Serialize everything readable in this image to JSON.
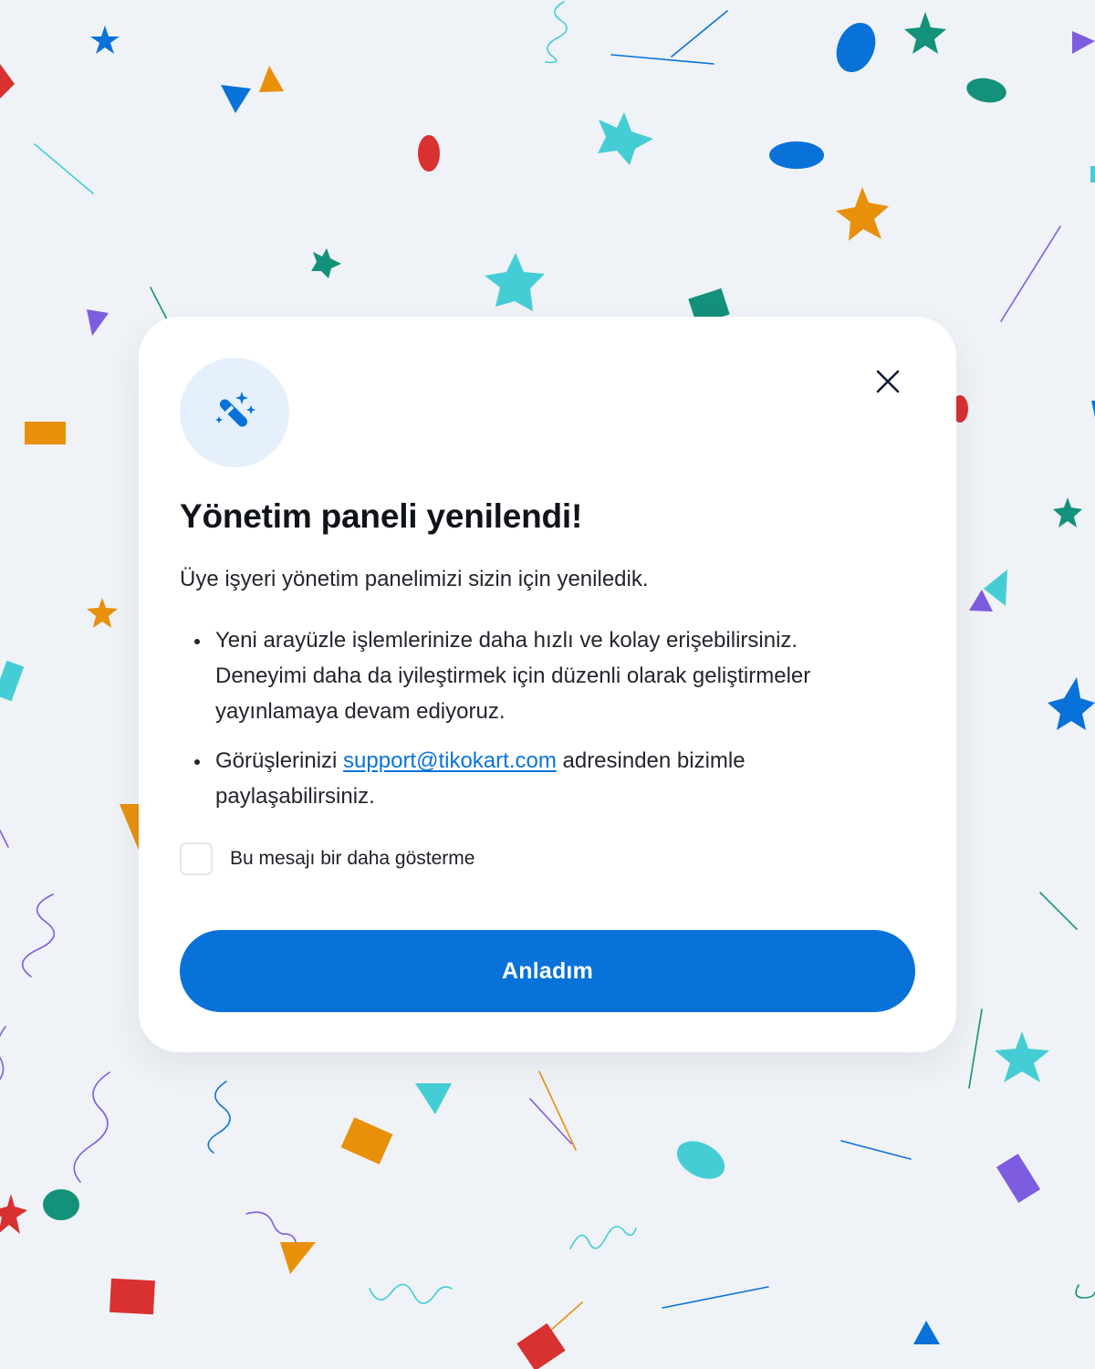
{
  "dialog": {
    "title": "Yönetim paneli yenilendi!",
    "intro": "Üye işyeri yönetim panelimizi sizin için yeniledik.",
    "bullet1": {
      "line1": "Yeni arayüzle işlemlerinize daha hızlı ve kolay erişebilirsiniz.",
      "line2": "Deneyimi daha da iyileştirmek için düzenli olarak geliştirmeler",
      "line3": "yayınlamaya devam ediyoruz."
    },
    "bullet2": {
      "before_link": "Görüşlerinizi ",
      "link": "support@tikokart.com",
      "after_link": " adresinden bizimle",
      "line2": "paylaşabilirsiniz."
    },
    "dont_show_label": "Bu mesajı bir daha gösterme",
    "dont_show_checked": false,
    "confirm_label": "Anladım",
    "icon": "magic-wand-icon",
    "close_icon": "close-icon"
  },
  "colors": {
    "background": "#eff2f6",
    "card": "#ffffff",
    "accent": "#0872d9",
    "link": "#0a73d9",
    "icon_badge": "#e5f0fc",
    "confetti": [
      "#0872d9",
      "#e8900a",
      "#d93030",
      "#14917a",
      "#45cdd6",
      "#7e5ce0"
    ]
  }
}
